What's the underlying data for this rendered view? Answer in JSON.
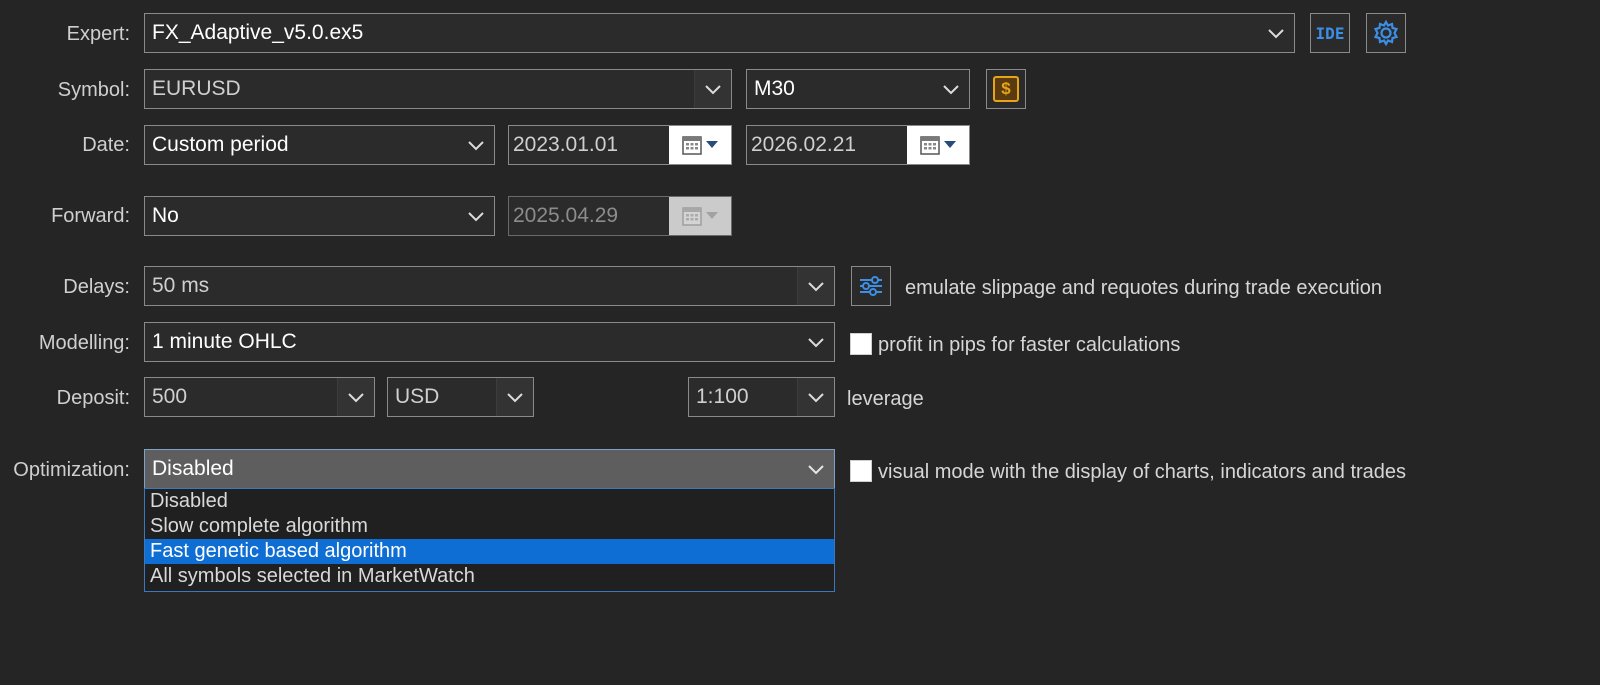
{
  "labels": {
    "expert": "Expert:",
    "symbol": "Symbol:",
    "date": "Date:",
    "forward": "Forward:",
    "delays": "Delays:",
    "modelling": "Modelling:",
    "deposit": "Deposit:",
    "optimization": "Optimization:"
  },
  "expert": {
    "value": "FX_Adaptive_v5.0.ex5",
    "ide_label": "IDE"
  },
  "symbol": {
    "value": "EURUSD",
    "timeframe": "M30",
    "spec_icon": "$"
  },
  "date": {
    "mode": "Custom period",
    "from": "2023.01.01",
    "to": "2026.02.21"
  },
  "forward": {
    "mode": "No",
    "date": "2025.04.29"
  },
  "delays": {
    "value": "50 ms",
    "description": "emulate slippage and requotes during trade execution"
  },
  "modelling": {
    "value": "1 minute OHLC",
    "checkbox_label": "profit in pips for faster calculations"
  },
  "deposit": {
    "amount": "500",
    "currency": "USD",
    "leverage": "1:100",
    "leverage_label": "leverage"
  },
  "optimization": {
    "value": "Disabled",
    "checkbox_label": "visual mode with the display of charts, indicators and trades",
    "options": [
      "Disabled",
      "Slow complete algorithm",
      "Fast genetic based algorithm",
      "All symbols selected in MarketWatch"
    ],
    "highlighted_index": 2
  },
  "colors": {
    "background": "#252526",
    "highlight": "#0f6ed3",
    "accent_icon": "#3d8fe6",
    "gold_icon": "#e8a317"
  }
}
